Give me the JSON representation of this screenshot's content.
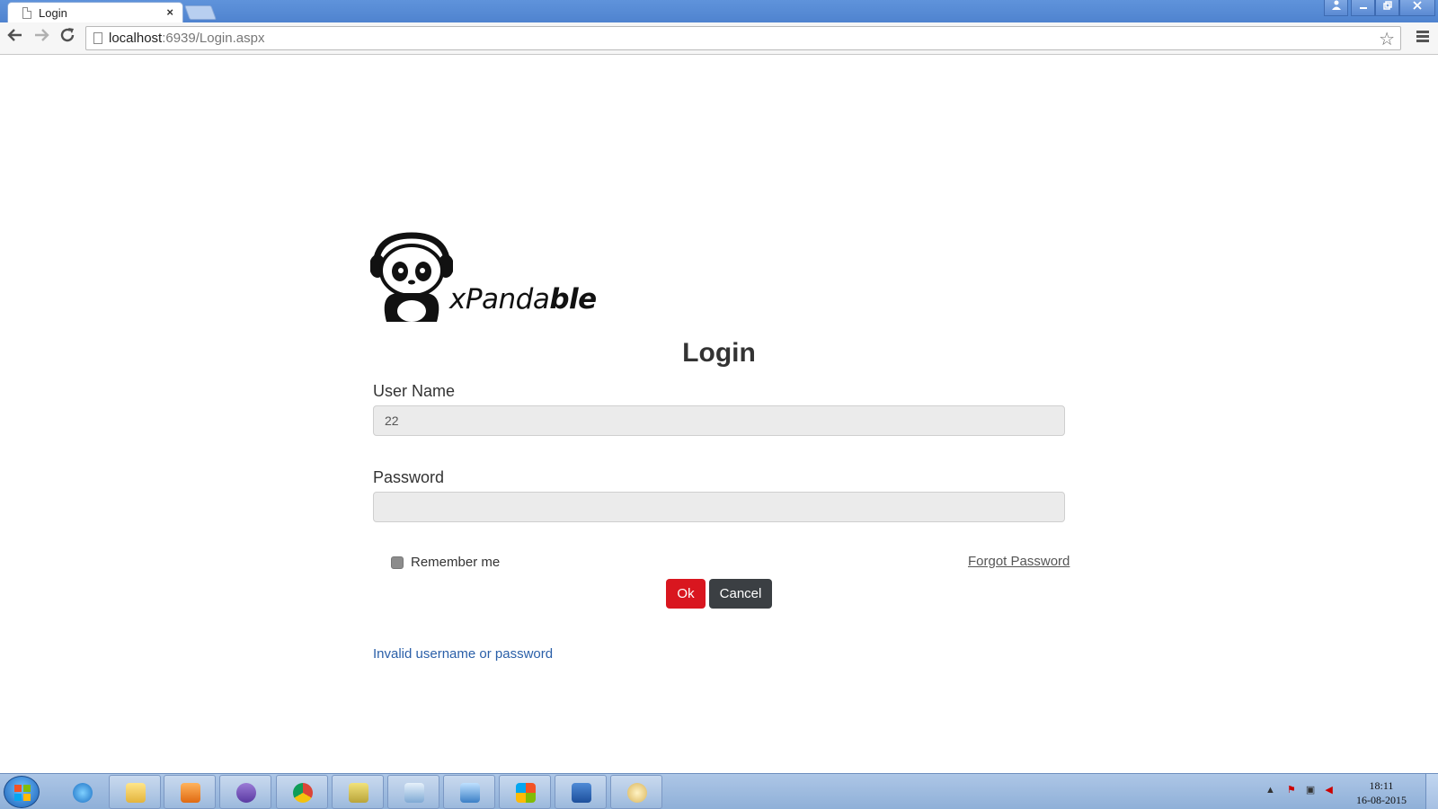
{
  "browser": {
    "tab_title": "Login",
    "tab_close": "×",
    "url_host": "localhost",
    "url_rest": ":6939/Login.aspx"
  },
  "logo": {
    "brand_text_light": "xPanda",
    "brand_text_bold": "ble"
  },
  "form": {
    "title": "Login",
    "username_label": "User Name",
    "username_value": "22",
    "password_label": "Password",
    "password_value": "",
    "remember_label": "Remember me",
    "remember_checked": false,
    "forgot_label": "Forgot Password",
    "ok_label": "Ok",
    "cancel_label": "Cancel",
    "error_message": "Invalid username or password"
  },
  "taskbar": {
    "apps": [
      "internet-explorer",
      "file-explorer",
      "media-player",
      "visual-studio",
      "chrome",
      "snipping-tool",
      "notepad",
      "control-panel",
      "security-center",
      "word",
      "paint"
    ],
    "time": "18:11",
    "date": "16-08-2015"
  },
  "colors": {
    "ok_button": "#d9161f",
    "cancel_button": "#3b3f43",
    "error_text": "#2a5fa8",
    "input_background": "#ebebeb"
  }
}
